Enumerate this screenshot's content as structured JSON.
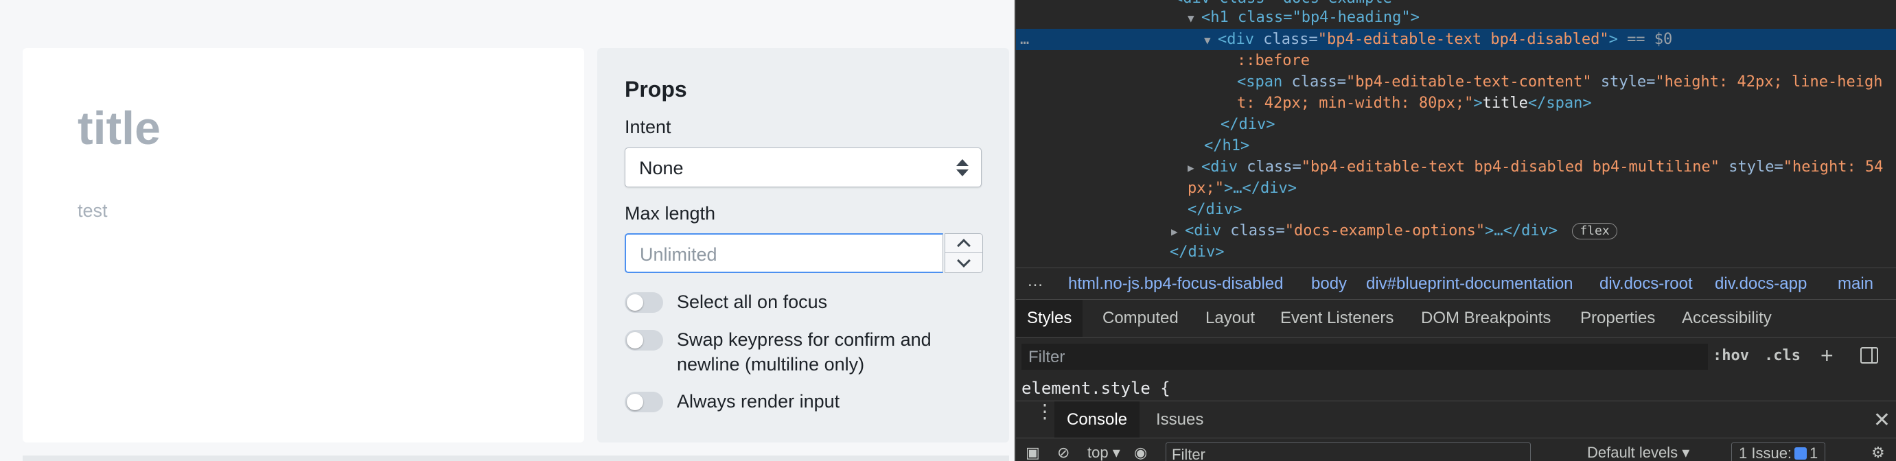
{
  "example": {
    "heading": "title",
    "multiline": "test"
  },
  "props": {
    "title": "Props",
    "intent_label": "Intent",
    "intent_value": "None",
    "maxlength_label": "Max length",
    "maxlength_placeholder": "Unlimited",
    "switches": [
      {
        "label": "Select all on focus",
        "checked": false
      },
      {
        "label": "Swap keypress for confirm and newline (multiline only)",
        "checked": false
      },
      {
        "label": "Always render input",
        "checked": false
      }
    ]
  },
  "devtools": {
    "dom": {
      "l1": "<h1 class=\"bp4-heading\">",
      "l2_tag": "<div",
      "l2_attr": "class=",
      "l2_val": "\"bp4-editable-text bp4-disabled\"",
      "l2_end": ">",
      "l2_ref": "== $0",
      "l3": "::before",
      "l4a_tag": "<span",
      "l4a_attr": "class=",
      "l4a_val": "\"bp4-editable-text-content\"",
      "l4a_attr2": "style=",
      "l4a_val2": "\"height: 42px; line-heigh",
      "l4b_val": "t: 42px; min-width: 80px;\"",
      "l4b_end": ">",
      "l4b_text": "title",
      "l4b_close": "</span>",
      "l5": "</div>",
      "l6": "</h1>",
      "l7a_tag": "<div",
      "l7a_attr": "class=",
      "l7a_val": "\"bp4-editable-text bp4-disabled bp4-multiline\"",
      "l7a_attr2": "style=",
      "l7a_val2": "\"height: 54",
      "l7b_val": "px;\"",
      "l7b_end": ">…</div>",
      "l8": "</div>",
      "l9_tag": "<div",
      "l9_attr": "class=",
      "l9_val": "\"docs-example-options\"",
      "l9_end": ">…</div>",
      "l9_badge": "flex",
      "l10": "</div>",
      "top_fragment": "<div class=\"docs-example"
    },
    "breadcrumbs": [
      "html.no-js.bp4-focus-disabled",
      "body",
      "div#blueprint-documentation",
      "div.docs-root",
      "div.docs-app",
      "main"
    ],
    "tabs": [
      "Styles",
      "Computed",
      "Layout",
      "Event Listeners",
      "DOM Breakpoints",
      "Properties",
      "Accessibility"
    ],
    "active_tab": "Styles",
    "filter_placeholder": "Filter",
    "hov": ":hov",
    "cls": ".cls",
    "plus": "+",
    "element_style": "element.style {",
    "drawer_tabs": [
      "Console",
      "Issues"
    ],
    "console": {
      "context": "top",
      "filter_placeholder": "Filter",
      "levels": "Default levels",
      "issues_prefix": "1 Issue:",
      "issues_count": "1"
    }
  }
}
